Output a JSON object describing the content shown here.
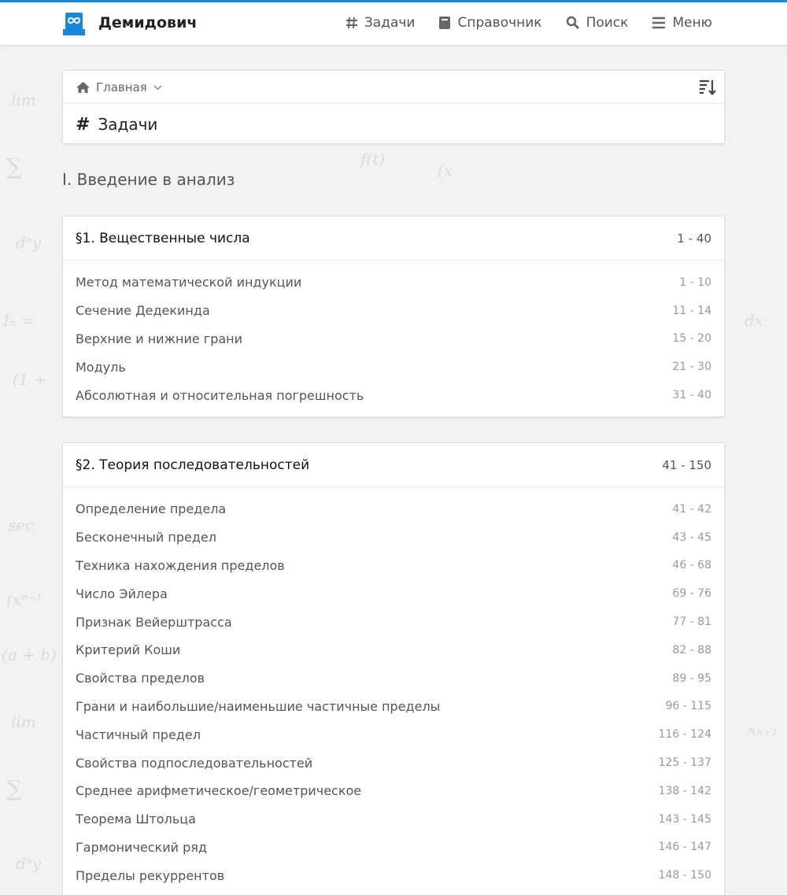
{
  "header": {
    "brand_name": "Демидович",
    "nav": [
      {
        "label": "Задачи",
        "icon": "hash-icon"
      },
      {
        "label": "Справочник",
        "icon": "book-icon"
      },
      {
        "label": "Поиск",
        "icon": "search-icon"
      },
      {
        "label": "Меню",
        "icon": "menu-icon"
      }
    ]
  },
  "breadcrumb": {
    "home_label": "Главная",
    "title_hash": "#",
    "page_title": "Задачи"
  },
  "chapter": {
    "title": "I. Введение в анализ"
  },
  "sections": [
    {
      "title": "§1. Вещественные числа",
      "range": "1 - 40",
      "items": [
        {
          "label": "Метод математической индукции",
          "range": "1 - 10"
        },
        {
          "label": "Сечение Дедекинда",
          "range": "11 - 14"
        },
        {
          "label": "Верхние и нижние грани",
          "range": "15 - 20"
        },
        {
          "label": "Модуль",
          "range": "21 - 30"
        },
        {
          "label": "Абсолютная и относительная погрешность",
          "range": "31 - 40"
        }
      ]
    },
    {
      "title": "§2. Теория последовательностей",
      "range": "41 - 150",
      "items": [
        {
          "label": "Определение предела",
          "range": "41 - 42"
        },
        {
          "label": "Бесконечный предел",
          "range": "43 - 45"
        },
        {
          "label": "Техника нахождения пределов",
          "range": "46 - 68"
        },
        {
          "label": "Число Эйлера",
          "range": "69 - 76"
        },
        {
          "label": "Признак Вейерштрасса",
          "range": "77 - 81"
        },
        {
          "label": "Критерий Коши",
          "range": "82 - 88"
        },
        {
          "label": "Свойства пределов",
          "range": "89 - 95"
        },
        {
          "label": "Грани и наибольшие/наименьшие частичные пределы",
          "range": "96 - 115"
        },
        {
          "label": "Частичный предел",
          "range": "116 - 124"
        },
        {
          "label": "Свойства подпоследовательностей",
          "range": "125 - 137"
        },
        {
          "label": "Среднее арифметическое/геометрическое",
          "range": "138 - 142"
        },
        {
          "label": "Теорема Штольца",
          "range": "143 - 145"
        },
        {
          "label": "Гармонический ряд",
          "range": "146 - 147"
        },
        {
          "label": "Пределы рекуррентов",
          "range": "148 - 150"
        }
      ]
    }
  ],
  "colors": {
    "accent": "#1a88d8",
    "background": "#f1f2f3"
  }
}
